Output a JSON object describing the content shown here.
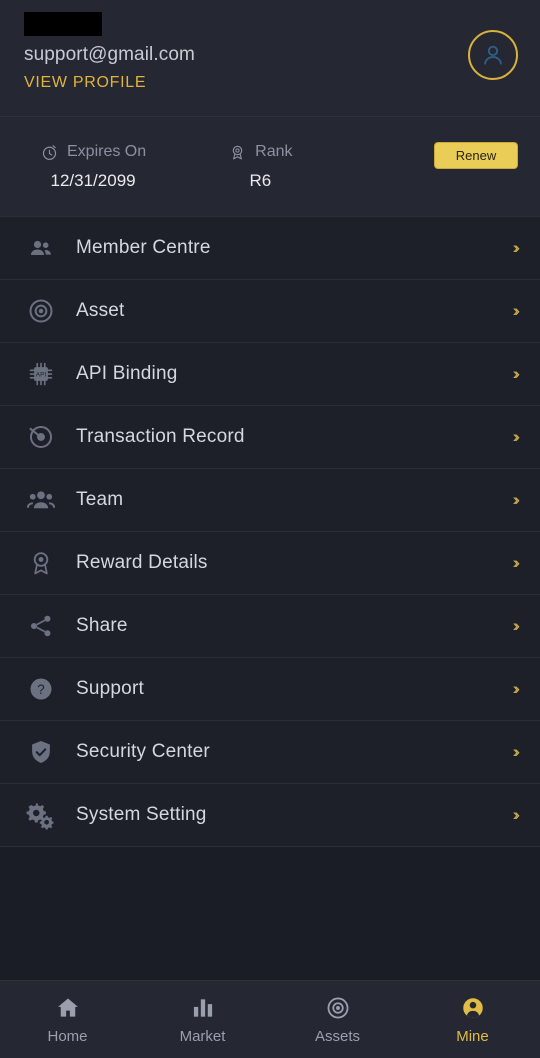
{
  "header": {
    "redacted_name": "",
    "email": "support@gmail.com",
    "view_profile_label": "VIEW PROFILE",
    "avatar_icon": "user-avatar-icon"
  },
  "info_bar": {
    "expires": {
      "icon": "clock-icon",
      "label": "Expires On",
      "value": "12/31/2099"
    },
    "rank": {
      "icon": "medal-icon",
      "label": "Rank",
      "value": "R6"
    },
    "renew_button": "Renew",
    "accent_color": "#eacd56"
  },
  "menu": {
    "chevron_glyph": "››",
    "items": [
      {
        "icon": "members-icon",
        "label": "Member Centre"
      },
      {
        "icon": "asset-circle-icon",
        "label": "Asset"
      },
      {
        "icon": "api-chip-icon",
        "label": "API Binding"
      },
      {
        "icon": "transaction-record-icon",
        "label": "Transaction Record"
      },
      {
        "icon": "team-icon",
        "label": "Team"
      },
      {
        "icon": "reward-medal-icon",
        "label": "Reward Details"
      },
      {
        "icon": "share-icon",
        "label": "Share"
      },
      {
        "icon": "support-question-icon",
        "label": "Support"
      },
      {
        "icon": "security-shield-icon",
        "label": "Security Center"
      },
      {
        "icon": "system-gears-icon",
        "label": "System Setting"
      }
    ]
  },
  "tabbar": {
    "items": [
      {
        "icon": "home-icon",
        "label": "Home",
        "active": false
      },
      {
        "icon": "market-bars-icon",
        "label": "Market",
        "active": false
      },
      {
        "icon": "assets-target-icon",
        "label": "Assets",
        "active": false
      },
      {
        "icon": "mine-person-icon",
        "label": "Mine",
        "active": true
      }
    ],
    "active_color": "#e0bb45",
    "inactive_color": "#9b9eab"
  }
}
